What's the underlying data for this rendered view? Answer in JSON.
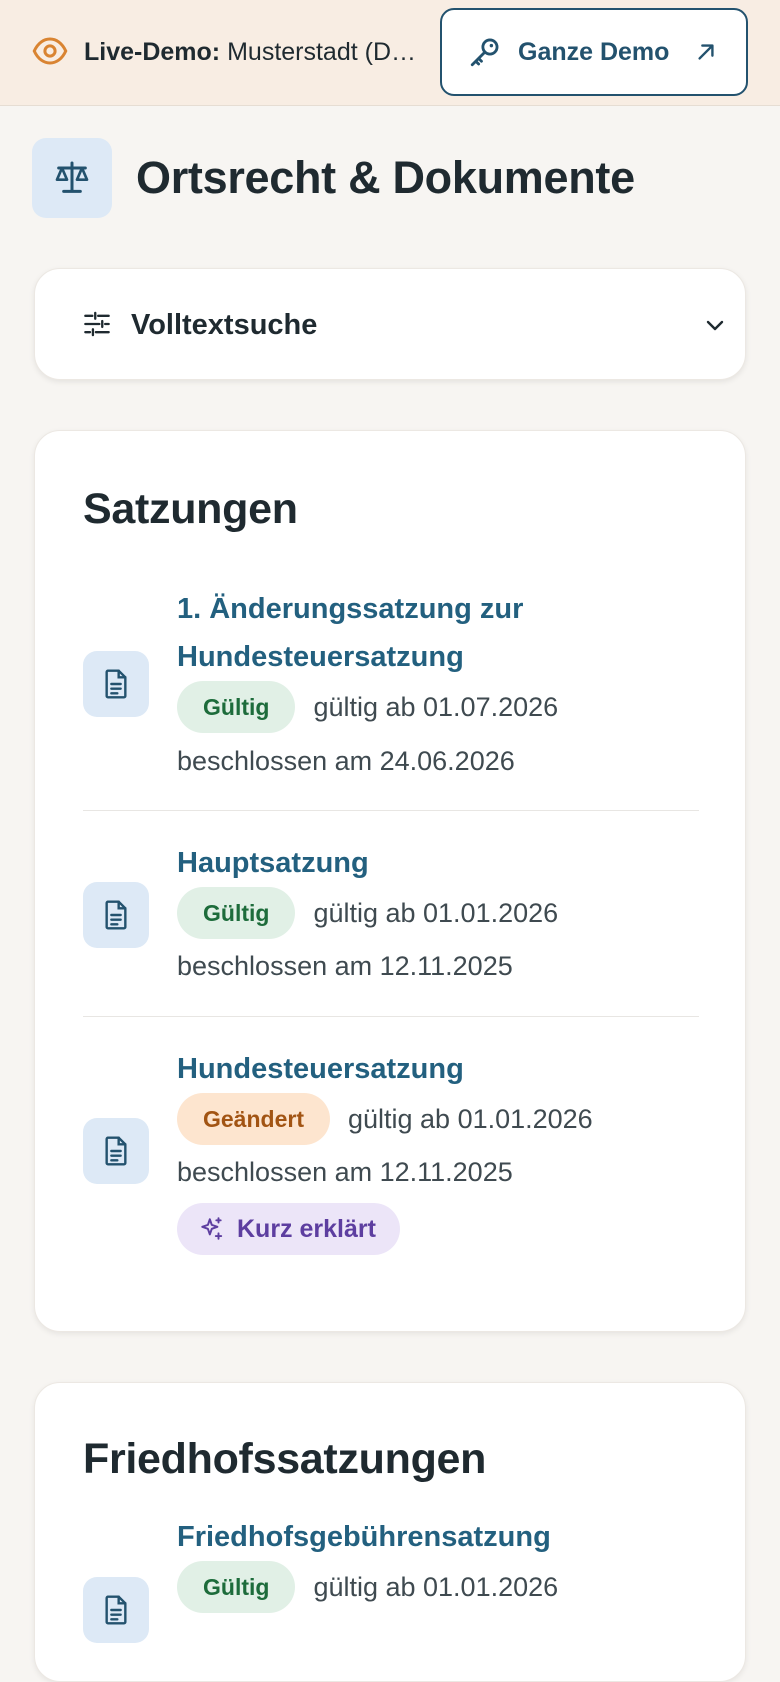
{
  "banner": {
    "live_label": "Live-Demo:",
    "live_text": " Musterstadt (Demo-Instanz)",
    "demo_button": "Ganze Demo"
  },
  "page": {
    "title": "Ortsrecht & Dokumente"
  },
  "search": {
    "label": "Volltextsuche"
  },
  "sections": [
    {
      "title": "Satzungen",
      "items": [
        {
          "title_line1": "1. Änderungssatzung zur",
          "title_line2": "Hundesteuersatzung",
          "status": "Gültig",
          "valid_from": "gültig ab 01.07.2026",
          "decided": "beschlossen am 24.06.2026"
        },
        {
          "title_line1": "Hauptsatzung",
          "status": "Gültig",
          "valid_from": "gültig ab 01.01.2026",
          "decided": "beschlossen am 12.11.2025"
        },
        {
          "title_line1": "Hundesteuersatzung",
          "status": "Geändert",
          "valid_from": "gültig ab 01.01.2026",
          "decided": "beschlossen am 12.11.2025",
          "extra": "Kurz erklärt"
        }
      ]
    },
    {
      "title": "Friedhofssatzungen",
      "items": [
        {
          "title_line1": "Friedhofsgebührensatzung",
          "status": "Gültig",
          "valid_from": "gültig ab 01.01.2026"
        }
      ]
    }
  ],
  "colors": {
    "accent": "#23607f",
    "valid_bg": "#e1f0e6",
    "changed_bg": "#fde5cf",
    "ai_bg": "#ece5f8"
  }
}
